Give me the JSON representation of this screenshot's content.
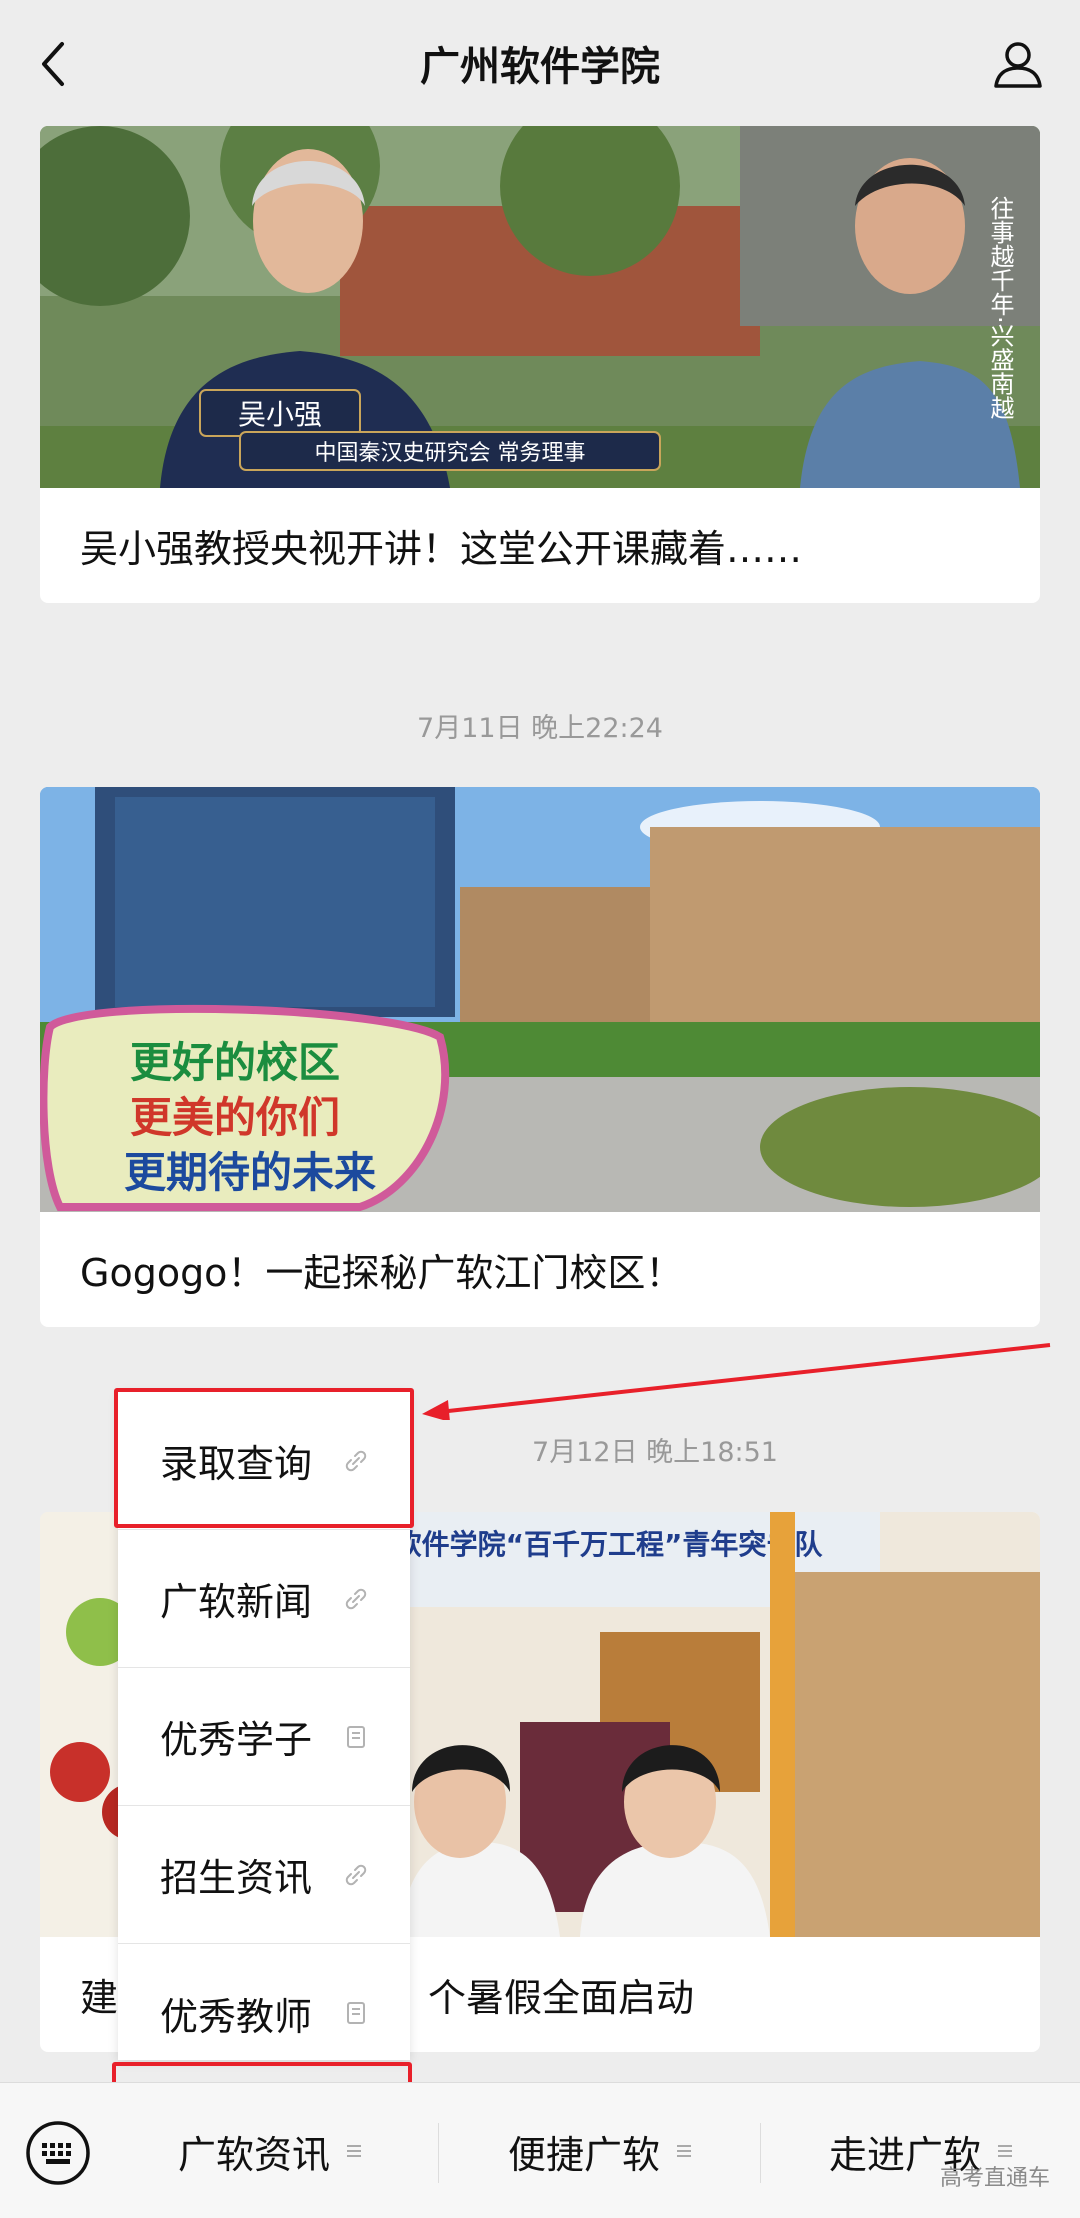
{
  "header": {
    "title": "广州软件学院"
  },
  "articles": [
    {
      "caption": "吴小强教授央视开讲！这堂公开课藏着……",
      "overlay": {
        "name": "吴小强",
        "role": "中国秦汉史研究会 常务理事",
        "side_text": "往事越千年·兴盛南越"
      }
    },
    {
      "timestamp": "7月11日 晚上22:24",
      "caption": "Gogogo！一起探秘广软江门校区！",
      "overlay": {
        "sign_lines": [
          "更好的校区",
          "更美的你们",
          "更期待的未来"
        ]
      }
    },
    {
      "timestamp": "7月12日 晚上18:51",
      "caption_left": "建",
      "caption_right": "个暑假全面启动",
      "overlay": {
        "banner": "广州软件学院“百千万工程”青年突击队"
      }
    }
  ],
  "popup_menu": {
    "items": [
      {
        "label": "录取查询",
        "icon": "link-icon"
      },
      {
        "label": "广软新闻",
        "icon": "link-icon"
      },
      {
        "label": "优秀学子",
        "icon": "article-icon"
      },
      {
        "label": "招生资讯",
        "icon": "link-icon"
      },
      {
        "label": "优秀教师",
        "icon": "article-icon"
      }
    ]
  },
  "bottom_menu": {
    "tabs": [
      {
        "label": "广软资讯"
      },
      {
        "label": "便捷广软"
      },
      {
        "label": "走进广软"
      }
    ]
  },
  "watermark": "高考直通车",
  "colors": {
    "highlight": "#e8202a",
    "background": "#ededed"
  }
}
